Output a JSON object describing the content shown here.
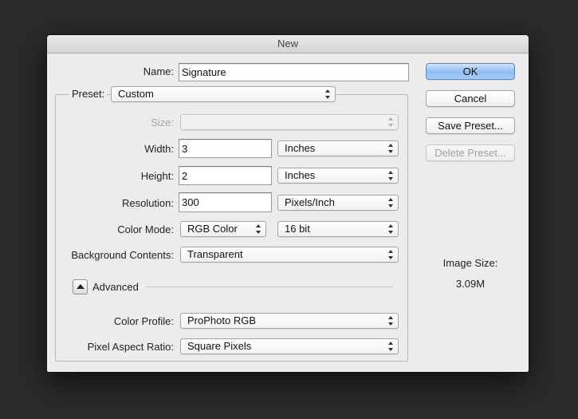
{
  "window": {
    "title": "New"
  },
  "form": {
    "name_label": "Name:",
    "name_value": "Signature",
    "preset_label": "Preset:",
    "preset_value": "Custom",
    "size_label": "Size:",
    "size_value": "",
    "width_label": "Width:",
    "width_value": "3",
    "width_unit": "Inches",
    "height_label": "Height:",
    "height_value": "2",
    "height_unit": "Inches",
    "resolution_label": "Resolution:",
    "resolution_value": "300",
    "resolution_unit": "Pixels/Inch",
    "color_mode_label": "Color Mode:",
    "color_mode_value": "RGB Color",
    "bit_depth_value": "16 bit",
    "background_label": "Background Contents:",
    "background_value": "Transparent",
    "advanced_label": "Advanced",
    "color_profile_label": "Color Profile:",
    "color_profile_value": "ProPhoto RGB",
    "pixel_aspect_label": "Pixel Aspect Ratio:",
    "pixel_aspect_value": "Square Pixels"
  },
  "buttons": {
    "ok": "OK",
    "cancel": "Cancel",
    "save_preset": "Save Preset...",
    "delete_preset": "Delete Preset..."
  },
  "image_size": {
    "label": "Image Size:",
    "value": "3.09M"
  },
  "colors": {
    "background": "#2b2b2b",
    "dialog": "#ececec",
    "default_button": "#8fbcf2"
  }
}
